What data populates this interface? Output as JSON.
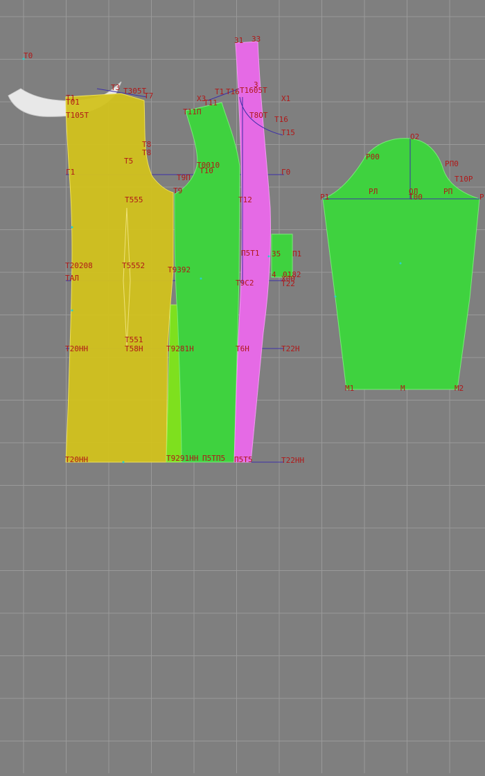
{
  "colors": {
    "background": "#7f7f7f",
    "grid": "#9a9a9a",
    "front_piece": "#d2c21e",
    "back_piece": "#3fd23f",
    "side_panel": "#e56ae5",
    "sleeve": "#3fd23f",
    "facing": "#e8e8e8",
    "side_wedge": "#7ee01e",
    "construction_line": "#3c2fa8",
    "label": "#b01818",
    "point": "#2bd0c8"
  },
  "labels": {
    "t0": "Т0",
    "t1": "Т1",
    "t01": "Т01",
    "t105t": "Т105Т",
    "t3": "Т3",
    "t305t": "Т305Т",
    "t7": "Т7",
    "t8a": "Т8",
    "t8b": "Т8",
    "t5": "Т5",
    "t9p": "Т9П",
    "t9": "Т9",
    "t555": "Т555",
    "g1": "Г1",
    "g0": "Г0",
    "t20208": "Т20208",
    "t5552": "Т5552",
    "t9392": "Т9392",
    "tal": "ТАЛ",
    "t20nn": "Т20НН",
    "t551": "Т551",
    "t58n": "Т58Н",
    "t92_81n": "Т9281Н",
    "t20nn2": "Т20НН",
    "t92_91nn": "Т9291НН",
    "t11p": "Т11П",
    "t0010": "Т0010",
    "t10": "Т10",
    "x3": "Х3",
    "t11": "Т11",
    "t1a": "Т1",
    "t16a": "Т16",
    "t12": "Т12",
    "p5t1": "П5Т1",
    "t6n": "Т6Н",
    "t9s2": "Т9С2",
    "p5t5": "П5Т5",
    "p5tp5": "П5ТП5",
    "v1": "31",
    "v2": "33",
    "v3": "3",
    "t1605t": "Т1605Т",
    "x1": "Х1",
    "t8ot": "Т8ОТ",
    "t16b": "Т16",
    "t15": "Т15",
    "s35": "35",
    "p1": "П1",
    "t22": "Т22",
    "t22n": "Т22Н",
    "t22nn": "Т22НН",
    "s4": "4",
    "o182": "0182",
    "x00": "Х00",
    "o2": "О2",
    "ro0": "Р00",
    "rp0": "РП0",
    "rl": "РЛ",
    "rp": "РП",
    "ol": "ОЛ",
    "t00": "Т00",
    "t10r": "Т10Р",
    "r1": "Р1",
    "rr": "Р",
    "m1": "М1",
    "m": "М",
    "m2": "М2"
  }
}
